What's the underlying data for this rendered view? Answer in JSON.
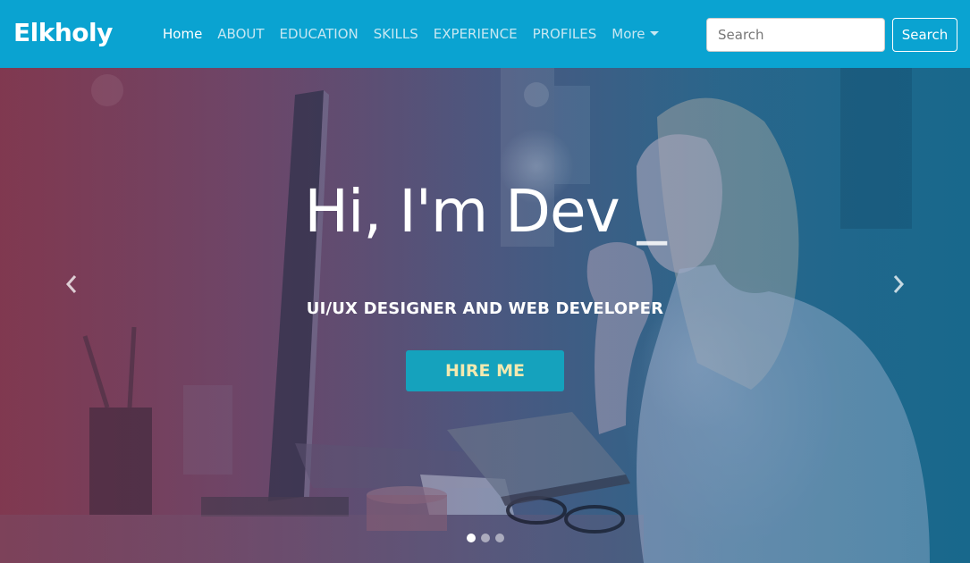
{
  "navbar": {
    "brand": "Elkholy",
    "links": [
      {
        "label": "Home"
      },
      {
        "label": "ABOUT"
      },
      {
        "label": "EDUCATION"
      },
      {
        "label": "SKILLS"
      },
      {
        "label": "EXPERIENCE"
      },
      {
        "label": "PROFILES"
      },
      {
        "label": "More"
      }
    ],
    "search": {
      "placeholder": "Search",
      "button_label": "Search"
    }
  },
  "hero": {
    "title": "Hi, I'm Dev",
    "cursor": "_",
    "subtitle": "UI/UX DESIGNER AND WEB DEVELOPER",
    "cta_label": "HIRE ME",
    "slides": {
      "count": 3,
      "active": 1
    }
  },
  "colors": {
    "navbar_bg": "#0aa3d1",
    "cta_bg": "#15a2bd",
    "cta_text": "#f2e9b0"
  }
}
